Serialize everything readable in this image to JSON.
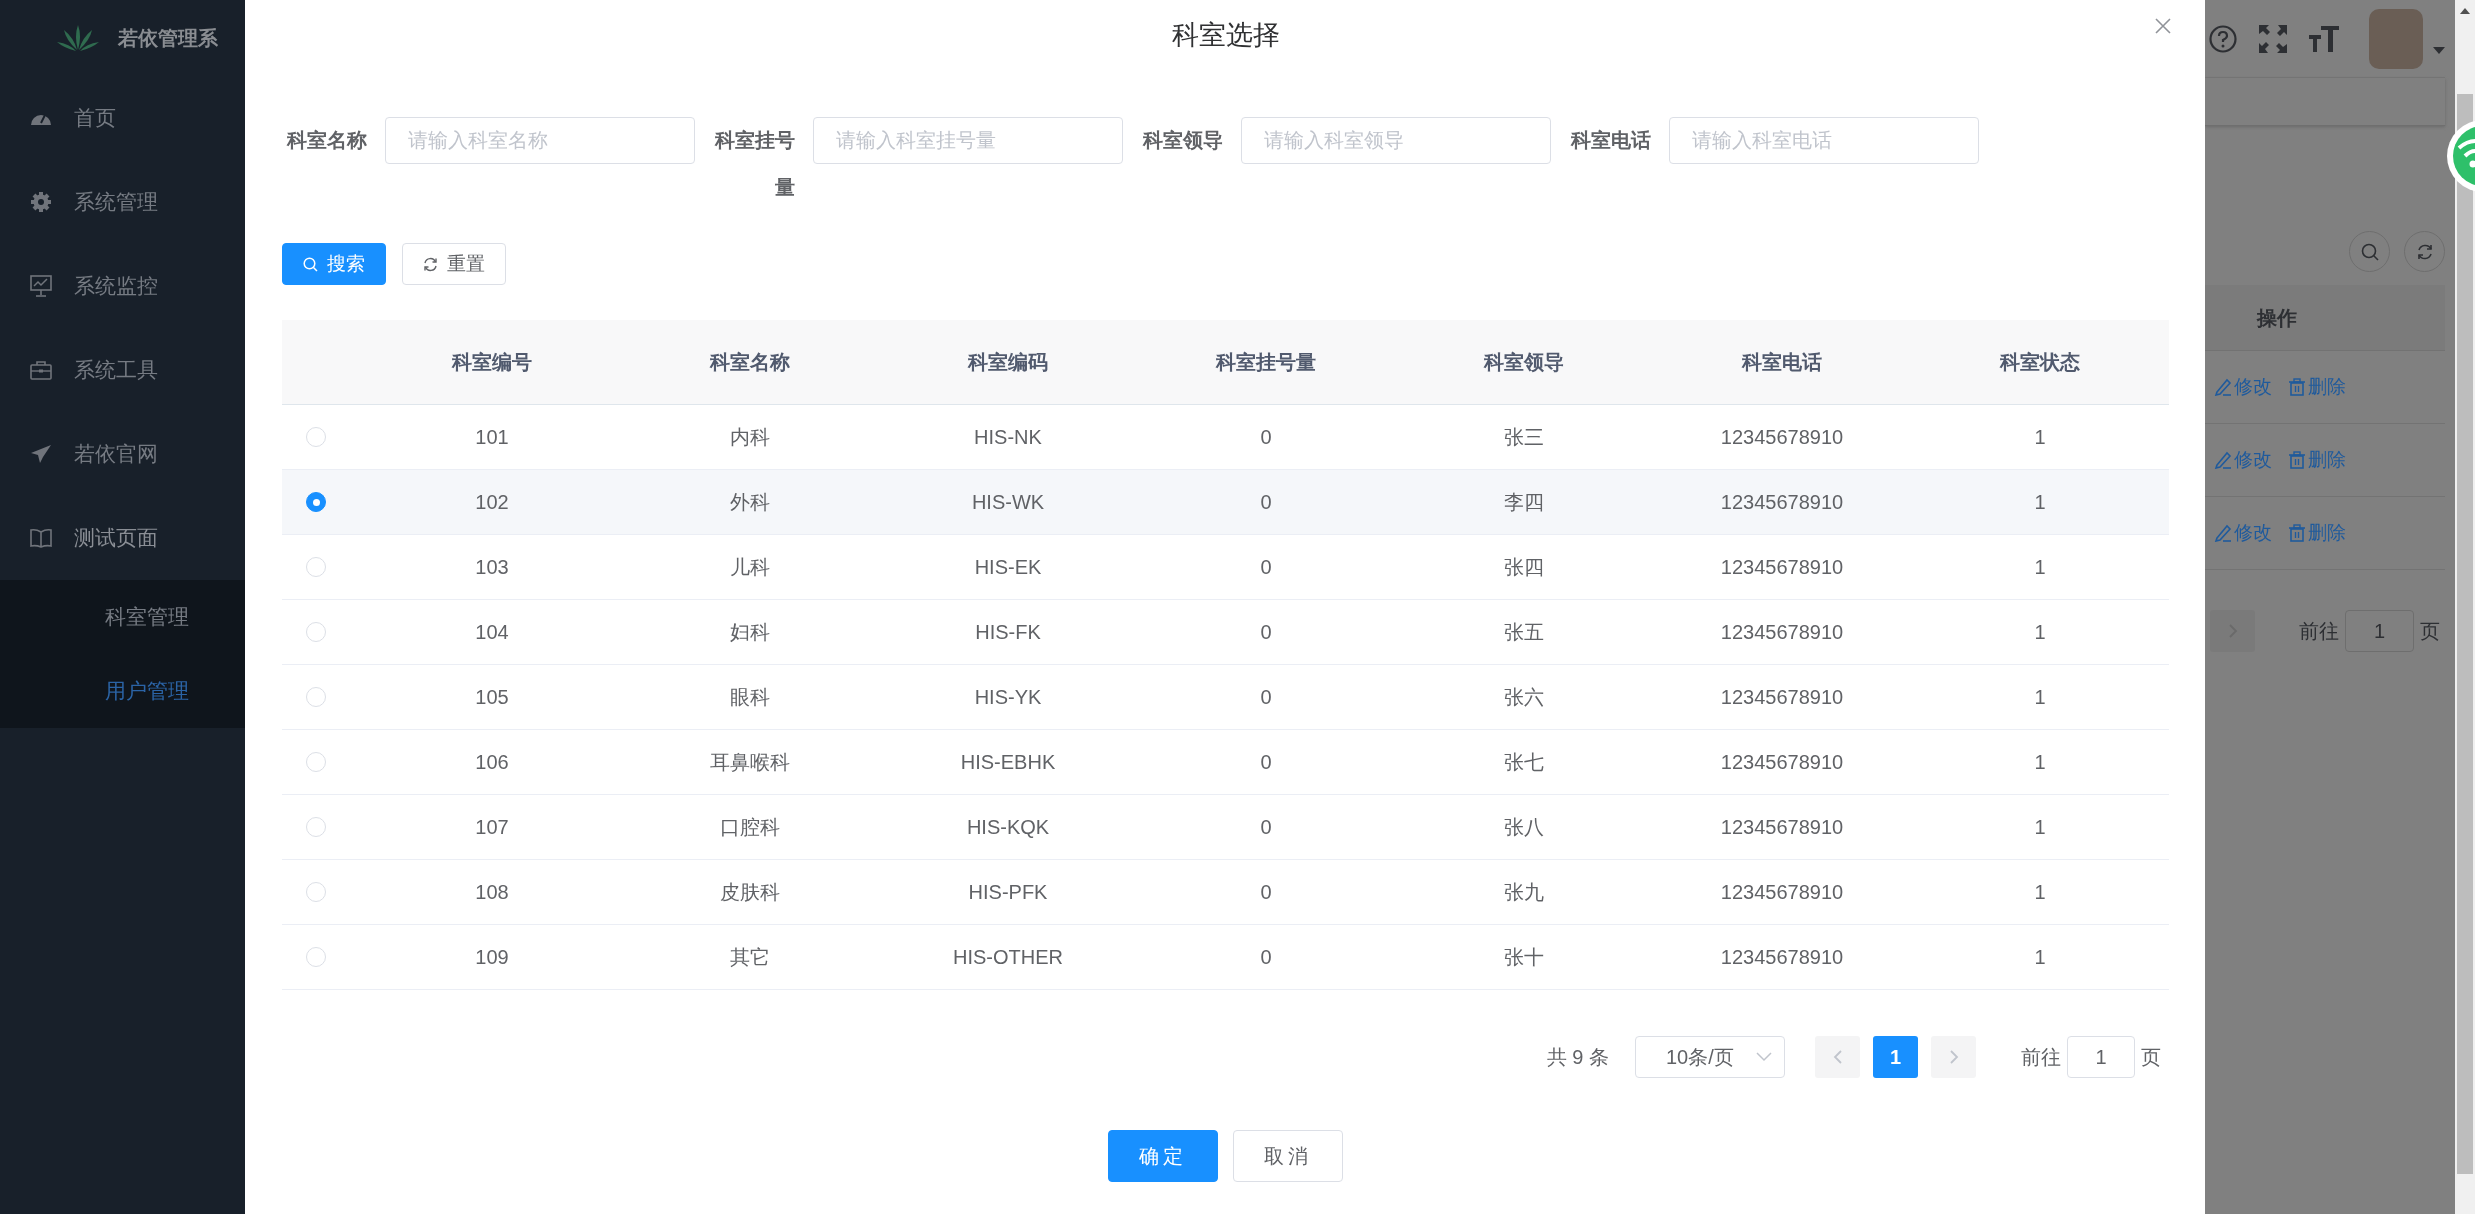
{
  "sidebar": {
    "logo_text": "若依管理系",
    "items": [
      {
        "label": "首页",
        "expanded": false
      },
      {
        "label": "系统管理",
        "expanded": false
      },
      {
        "label": "系统监控",
        "expanded": false
      },
      {
        "label": "系统工具",
        "expanded": false
      },
      {
        "label": "若依官网",
        "expanded": false
      },
      {
        "label": "测试页面",
        "expanded": true,
        "children": [
          {
            "label": "科室管理",
            "selected": false
          },
          {
            "label": "用户管理",
            "selected": true
          }
        ]
      }
    ]
  },
  "background_table": {
    "columns": [
      "操作"
    ],
    "rows": [
      {
        "actions": [
          "修改",
          "删除"
        ]
      },
      {
        "actions": [
          "修改",
          "删除"
        ]
      },
      {
        "actions": [
          "修改",
          "删除"
        ]
      }
    ]
  },
  "background_pagination": {
    "goto_label": "前往",
    "goto_value": "1",
    "goto_suffix": "页"
  },
  "dialog": {
    "title": "科室选择",
    "filters": [
      {
        "label": "科室名称",
        "placeholder": "请输入科室名称"
      },
      {
        "label": "科室挂号量",
        "placeholder": "请输入科室挂号量"
      },
      {
        "label": "科室领导",
        "placeholder": "请输入科室领导"
      },
      {
        "label": "科室电话",
        "placeholder": "请输入科室电话"
      }
    ],
    "buttons": [
      "搜索",
      "重置"
    ],
    "table": {
      "columns": [
        "科室编号",
        "科室名称",
        "科室编码",
        "科室挂号量",
        "科室领导",
        "科室电话",
        "科室状态"
      ],
      "rows": [
        {
          "cells": [
            "101",
            "内科",
            "HIS-NK",
            "0",
            "张三",
            "12345678910",
            "1"
          ],
          "selected": false
        },
        {
          "cells": [
            "102",
            "外科",
            "HIS-WK",
            "0",
            "李四",
            "12345678910",
            "1"
          ],
          "selected": true
        },
        {
          "cells": [
            "103",
            "儿科",
            "HIS-EK",
            "0",
            "张四",
            "12345678910",
            "1"
          ],
          "selected": false
        },
        {
          "cells": [
            "104",
            "妇科",
            "HIS-FK",
            "0",
            "张五",
            "12345678910",
            "1"
          ],
          "selected": false
        },
        {
          "cells": [
            "105",
            "眼科",
            "HIS-YK",
            "0",
            "张六",
            "12345678910",
            "1"
          ],
          "selected": false
        },
        {
          "cells": [
            "106",
            "耳鼻喉科",
            "HIS-EBHK",
            "0",
            "张七",
            "12345678910",
            "1"
          ],
          "selected": false
        },
        {
          "cells": [
            "107",
            "口腔科",
            "HIS-KQK",
            "0",
            "张八",
            "12345678910",
            "1"
          ],
          "selected": false
        },
        {
          "cells": [
            "108",
            "皮肤科",
            "HIS-PFK",
            "0",
            "张九",
            "12345678910",
            "1"
          ],
          "selected": false
        },
        {
          "cells": [
            "109",
            "其它",
            "HIS-OTHER",
            "0",
            "张十",
            "12345678910",
            "1"
          ],
          "selected": false
        }
      ]
    },
    "pagination": {
      "total": "共 9 条",
      "page_size": "10条/页",
      "pages": [
        {
          "label": "1",
          "selected": true
        }
      ],
      "goto_label": "前往",
      "goto_value": "1",
      "goto_suffix": "页"
    },
    "footer": [
      "确定",
      "取消"
    ]
  }
}
